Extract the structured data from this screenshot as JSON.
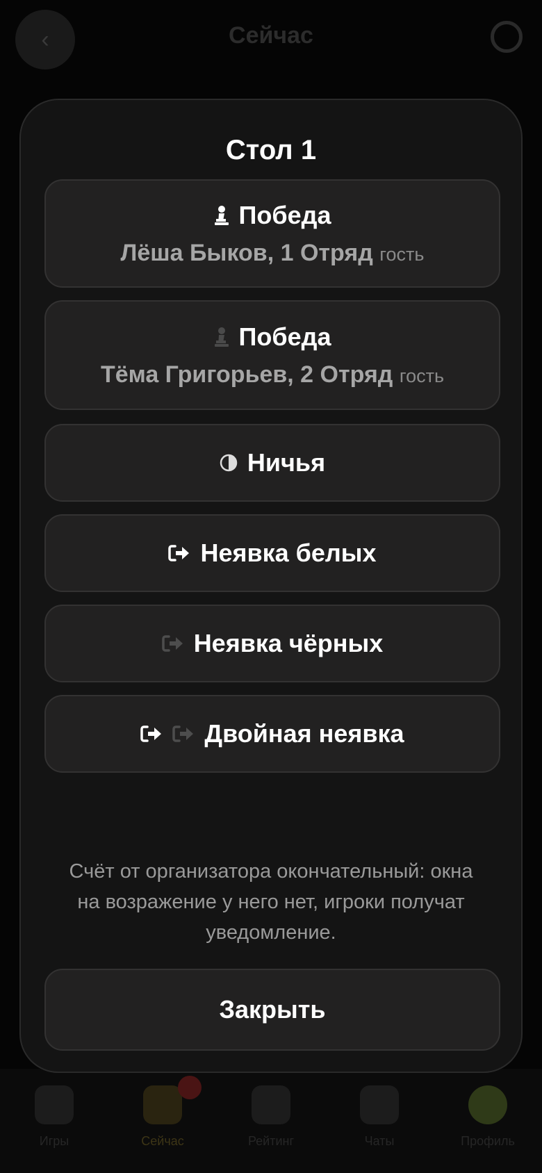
{
  "background": {
    "header_title": "Сейчас",
    "nav": [
      "Игры",
      "Сейчас",
      "Рейтинг",
      "Чаты",
      "Профиль"
    ]
  },
  "modal": {
    "title": "Стол 1",
    "options": [
      {
        "icon": "white-pawn-icon",
        "label": "Победа",
        "player": "Лёша Быков, 1 Отряд",
        "tag": "гость"
      },
      {
        "icon": "black-pawn-icon",
        "label": "Победа",
        "player": "Тёма Григорьев, 2 Отряд",
        "tag": "гость"
      },
      {
        "icon": "half-circle-icon",
        "label": "Ничья"
      },
      {
        "icon": "exit-white-icon",
        "label": "Неявка белых"
      },
      {
        "icon": "exit-dim-icon",
        "label": "Неявка чёрных"
      },
      {
        "icon": "double-exit-icon",
        "label": "Двойная неявка"
      }
    ],
    "note": "Счёт от организатора окончательный: окна на возражение у него нет, игроки получат уведомление.",
    "close_label": "Закрыть"
  }
}
